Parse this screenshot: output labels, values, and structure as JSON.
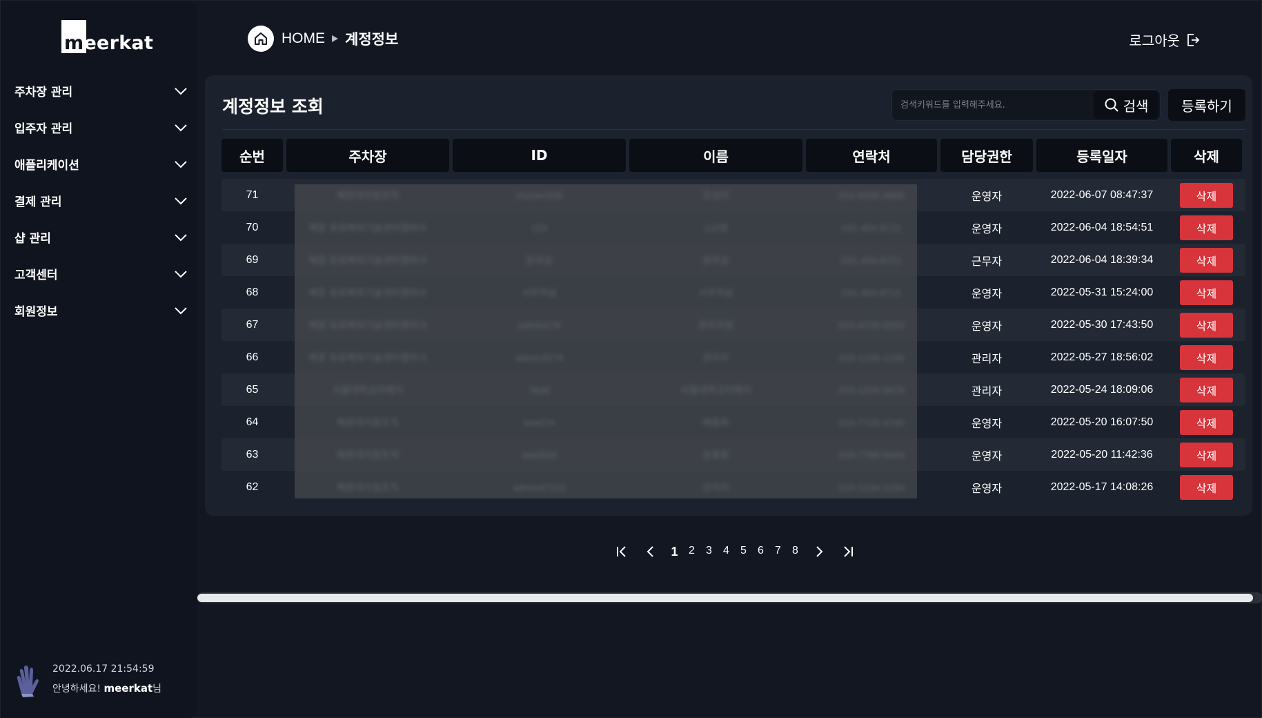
{
  "brand": {
    "name": "meerkat"
  },
  "sidebar": {
    "items": [
      {
        "label": "주차장 관리"
      },
      {
        "label": "입주자 관리"
      },
      {
        "label": "애플리케이션"
      },
      {
        "label": "결제 관리"
      },
      {
        "label": "샵 관리"
      },
      {
        "label": "고객센터"
      },
      {
        "label": "회원정보"
      }
    ],
    "user": {
      "datetime": "2022.06.17 21:54:59",
      "greeting": "안녕하세요!",
      "name": "meerkat",
      "suffix": "님"
    }
  },
  "header": {
    "home_label": "HOME",
    "current_page": "계정정보",
    "logout_label": "로그아웃"
  },
  "main": {
    "title": "계정정보 조회",
    "search": {
      "placeholder": "검색키워드를 입력해주세요.",
      "value": "",
      "button_label": "검색"
    },
    "register_label": "등록하기",
    "columns": [
      "순번",
      "주차장",
      "ID",
      "이름",
      "연락처",
      "담당권한",
      "등록일자",
      "삭제"
    ],
    "rows": [
      {
        "no": "71",
        "lot": "해운대지점조직",
        "id": "choseri336",
        "name": "조성아",
        "phone": "010-9935-4889",
        "role": "운영자",
        "date": "2022-06-07 08:47:37",
        "action": "삭제"
      },
      {
        "no": "70",
        "lot": "해운 유료해외기술센터챔피사",
        "id": "123",
        "name": "110정",
        "phone": "031-454-8721",
        "role": "운영자",
        "date": "2022-06-04 18:54:51",
        "action": "삭제"
      },
      {
        "no": "69",
        "lot": "해운 유료해외기술센터챔피사",
        "id": "분비실",
        "name": "분비실",
        "phone": "031-454-8721",
        "role": "근무자",
        "date": "2022-06-04 18:39:34",
        "action": "삭제"
      },
      {
        "no": "68",
        "lot": "해운 유료해외기술센터챔피사",
        "id": "사무처실",
        "name": "사무처실",
        "phone": "031-454-8721",
        "role": "운영자",
        "date": "2022-05-31 15:24:00",
        "action": "삭제"
      },
      {
        "no": "67",
        "lot": "해운 유료해외기술센터챔피사",
        "id": "admin278",
        "name": "관리자원",
        "phone": "010-4725-9250",
        "role": "운영자",
        "date": "2022-05-30 17:43:50",
        "action": "삭제"
      },
      {
        "no": "66",
        "lot": "해운 유료해외기술센터챔피사",
        "id": "admin3278",
        "name": "관리자",
        "phone": "010-1234-1234",
        "role": "관리자",
        "date": "2022-05-27 18:56:02",
        "action": "삭제"
      },
      {
        "no": "65",
        "lot": "서울대학교이해지",
        "id": "Testt",
        "name": "서울대학교이해지",
        "phone": "010-1234-5678",
        "role": "관리자",
        "date": "2022-05-24 18:09:06",
        "action": "삭제"
      },
      {
        "no": "64",
        "lot": "해운대지점조직",
        "id": "bseil74",
        "name": "배용화",
        "phone": "010-7725-4740",
        "role": "운영자",
        "date": "2022-05-20 16:07:50",
        "action": "삭제"
      },
      {
        "no": "63",
        "lot": "해운대지점조직",
        "id": "ata2929",
        "name": "송용호",
        "phone": "010-7788-5444",
        "role": "운영자",
        "date": "2022-05-20 11:42:36",
        "action": "삭제"
      },
      {
        "no": "62",
        "lot": "해운대지점조직",
        "id": "admin47212",
        "name": "관리자",
        "phone": "010-1234-1234",
        "role": "운영자",
        "date": "2022-05-17 14:08:26",
        "action": "삭제"
      }
    ]
  },
  "pagination": {
    "pages": [
      "1",
      "2",
      "3",
      "4",
      "5",
      "6",
      "7",
      "8"
    ],
    "current": "1"
  },
  "colors": {
    "background": "#121722",
    "sidebar": "#0f141e",
    "card": "#1b212d",
    "header_cell": "#0b0f15",
    "delete_button": "#d7343c"
  }
}
